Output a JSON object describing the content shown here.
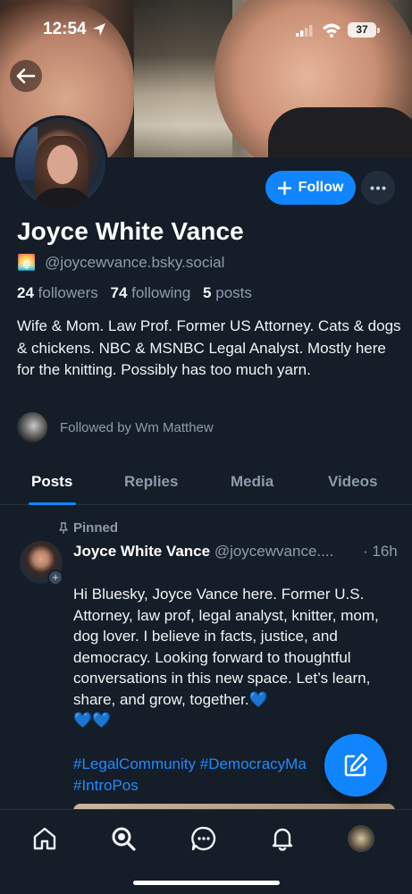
{
  "status_bar": {
    "time": "12:54",
    "battery": "37"
  },
  "profile": {
    "display_name": "Joyce White Vance",
    "handle_emoji": "🌅",
    "handle": "@joycewvance.bsky.social",
    "followers_count": "24",
    "followers_label": "followers",
    "following_count": "74",
    "following_label": "following",
    "posts_count": "5",
    "posts_label": "posts",
    "bio": "Wife & Mom. Law Prof. Former US Attorney. Cats & dogs & chickens. NBC & MSNBC Legal Analyst. Mostly here for the knitting. Possibly has too much yarn.",
    "followed_by": "Followed by Wm Matthew"
  },
  "actions": {
    "follow_label": "Follow"
  },
  "tabs": [
    "Posts",
    "Replies",
    "Media",
    "Videos"
  ],
  "post": {
    "pinned_label": "Pinned",
    "author_name": "Joyce White Vance",
    "author_handle": "@joycewvance....",
    "time": "· 16h",
    "text": "Hi Bluesky, Joyce Vance here. Former U.S. Attorney, law prof, legal analyst, knitter, mom, dog lover. I believe in facts, justice, and democracy. Looking forward to thoughtful conversations in this new space. Let’s learn, share, and grow, together.💙",
    "hearts": "💙💙",
    "tags": "#LegalCommunity #DemocracyMa",
    "tags_line2": "#IntroPos"
  },
  "colors": {
    "accent": "#1185fe",
    "background": "#151d28",
    "muted": "#8d9bab"
  },
  "icons": [
    "back-arrow-icon",
    "location-arrow-icon",
    "signal-icon",
    "wifi-icon",
    "battery-icon",
    "plus-icon",
    "ellipsis-icon",
    "pin-icon",
    "compose-icon",
    "home-icon",
    "search-icon",
    "chat-icon",
    "bell-icon"
  ]
}
